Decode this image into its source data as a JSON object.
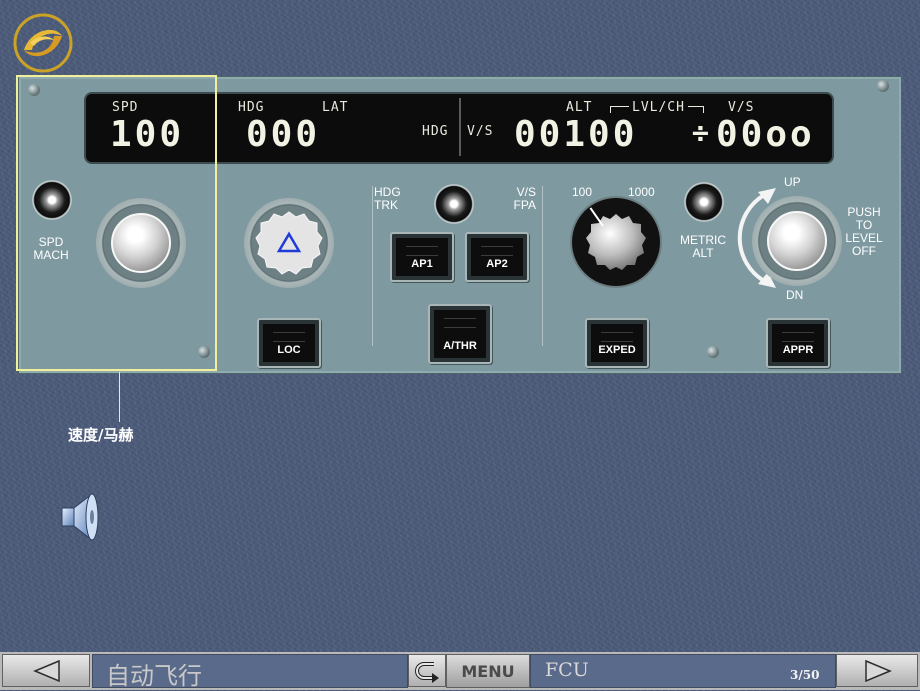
{
  "fcu": {
    "speed_display": {
      "label": "SPD",
      "value": "100"
    },
    "heading_display": {
      "label_left": "HDG",
      "label_right": "LAT",
      "value": "000",
      "mode_hdg": "HDG",
      "mode_vs": "V/S"
    },
    "altitude_display": {
      "label_alt": "ALT",
      "label_lvl": "LVL/CH",
      "label_vs": "V/S",
      "alt_value": "00100",
      "vs_value": "00oo",
      "vs_sign": "÷"
    },
    "spd_mach_label": [
      "SPD",
      "MACH"
    ],
    "hdg_trk_label": [
      "HDG",
      "TRK"
    ],
    "vs_fpa_label": [
      "V/S",
      "FPA"
    ],
    "alt_increment_labels": {
      "left": "100",
      "right": "1000"
    },
    "metric_alt_label": [
      "METRIC",
      "ALT"
    ],
    "up_label": "UP",
    "dn_label": "DN",
    "push_to_level_off_label": [
      "PUSH",
      "TO",
      "LEVEL",
      "OFF"
    ],
    "buttons": {
      "loc": "LOC",
      "ap1": "AP1",
      "ap2": "AP2",
      "athr": "A/THR",
      "exped": "EXPED",
      "appr": "APPR"
    }
  },
  "callout": {
    "label": "速度/马赫",
    "color": "#f1f09a"
  },
  "nav": {
    "title": "自动飞行",
    "menu_label": "MENU",
    "section": "FCU",
    "page": "3/50",
    "icons": [
      "prev-arrow-icon",
      "return-icon",
      "next-arrow-icon"
    ]
  },
  "colors": {
    "panel": "#7e9aa0",
    "display": "#0c0c0c",
    "background": "#4a5a78"
  }
}
